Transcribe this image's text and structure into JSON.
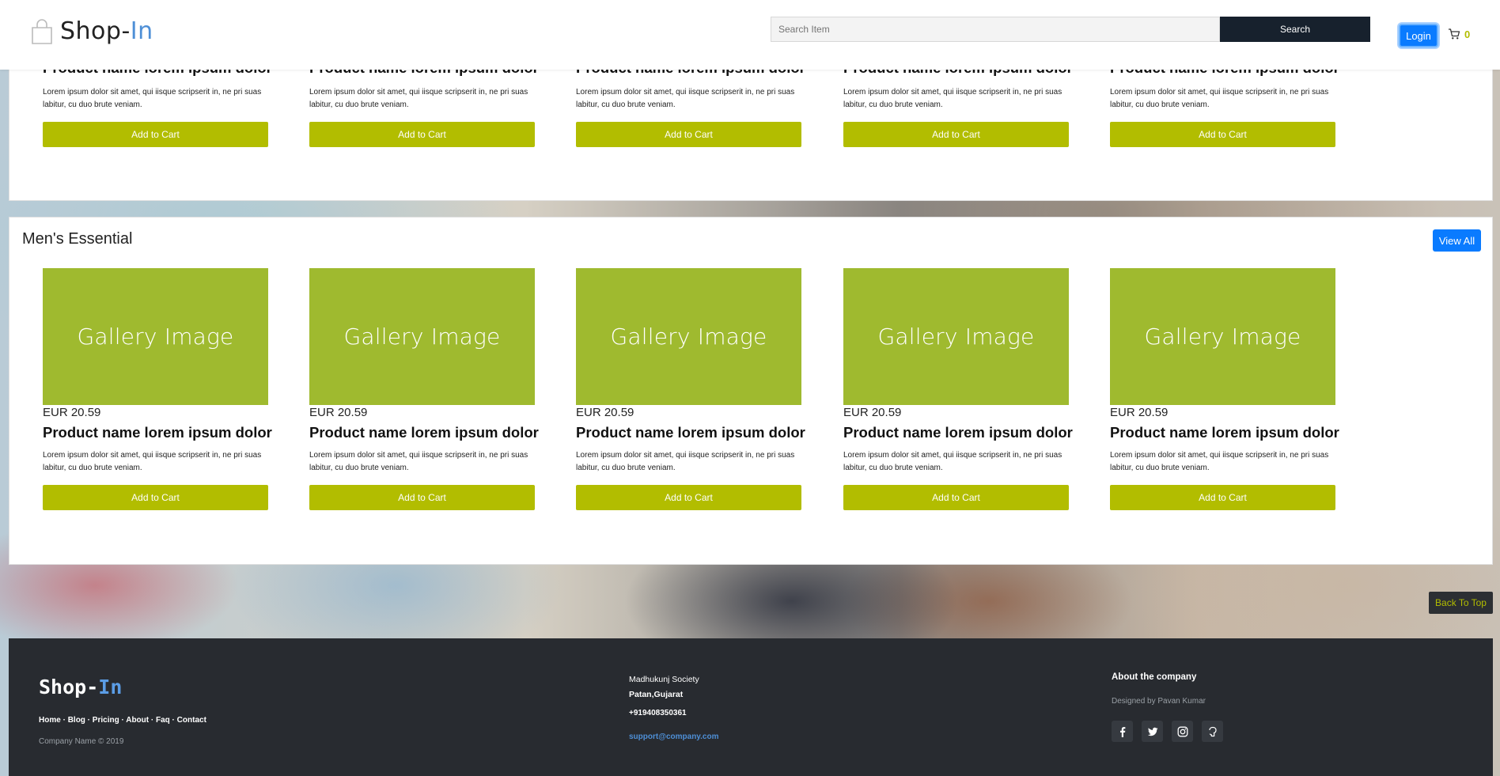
{
  "header": {
    "logo_text": "Shop-",
    "logo_accent": "In",
    "search_placeholder": "Search Item",
    "search_label": "Search",
    "login_label": "Login",
    "cart_count": "0"
  },
  "colors": {
    "accent_green": "#b2bd00",
    "gallery_green": "#9fba2f",
    "primary_blue": "#0a7bff",
    "dark": "#17212d"
  },
  "top_section": {
    "products": [
      {
        "name": "Product name lorem ipsum dolor",
        "desc": "Lorem ipsum dolor sit amet, qui iisque scripserit in, ne pri suas labitur, cu duo brute veniam.",
        "button": "Add to Cart"
      },
      {
        "name": "Product name lorem ipsum dolor",
        "desc": "Lorem ipsum dolor sit amet, qui iisque scripserit in, ne pri suas labitur, cu duo brute veniam.",
        "button": "Add to Cart"
      },
      {
        "name": "Product name lorem ipsum dolor",
        "desc": "Lorem ipsum dolor sit amet, qui iisque scripserit in, ne pri suas labitur, cu duo brute veniam.",
        "button": "Add to Cart"
      },
      {
        "name": "Product name lorem ipsum dolor",
        "desc": "Lorem ipsum dolor sit amet, qui iisque scripserit in, ne pri suas labitur, cu duo brute veniam.",
        "button": "Add to Cart"
      },
      {
        "name": "Product name lorem ipsum dolor",
        "desc": "Lorem ipsum dolor sit amet, qui iisque scripserit in, ne pri suas labitur, cu duo brute veniam.",
        "button": "Add to Cart"
      }
    ]
  },
  "mens_section": {
    "title": "Men's Essential",
    "view_all": "View All",
    "products": [
      {
        "image": "Gallery Image",
        "price": "EUR 20.59",
        "name": "Product name lorem ipsum dolor",
        "desc": "Lorem ipsum dolor sit amet, qui iisque scripserit in, ne pri suas labitur, cu duo brute veniam.",
        "button": "Add to Cart"
      },
      {
        "image": "Gallery Image",
        "price": "EUR 20.59",
        "name": "Product name lorem ipsum dolor",
        "desc": "Lorem ipsum dolor sit amet, qui iisque scripserit in, ne pri suas labitur, cu duo brute veniam.",
        "button": "Add to Cart"
      },
      {
        "image": "Gallery Image",
        "price": "EUR 20.59",
        "name": "Product name lorem ipsum dolor",
        "desc": "Lorem ipsum dolor sit amet, qui iisque scripserit in, ne pri suas labitur, cu duo brute veniam.",
        "button": "Add to Cart"
      },
      {
        "image": "Gallery Image",
        "price": "EUR 20.59",
        "name": "Product name lorem ipsum dolor",
        "desc": "Lorem ipsum dolor sit amet, qui iisque scripserit in, ne pri suas labitur, cu duo brute veniam.",
        "button": "Add to Cart"
      },
      {
        "image": "Gallery Image",
        "price": "EUR 20.59",
        "name": "Product name lorem ipsum dolor",
        "desc": "Lorem ipsum dolor sit amet, qui iisque scripserit in, ne pri suas labitur, cu duo brute veniam.",
        "button": "Add to Cart"
      }
    ]
  },
  "back_to_top": "Back To Top",
  "footer": {
    "logo_text": "Shop-",
    "logo_accent": "In",
    "links": [
      "Home",
      "Blog",
      "Pricing",
      "About",
      "Faq",
      "Contact"
    ],
    "link_separator": " · ",
    "copyright": "Company Name © 2019",
    "address_line1": "Madhukunj Society",
    "address_line2": "Patan,Gujarat",
    "phone": "+919408350361",
    "email": "support@company.com",
    "about_title": "About the company",
    "designed_by": "Designed by Pavan Kumar",
    "socials": [
      "facebook-icon",
      "twitter-icon",
      "instagram-icon",
      "github-icon"
    ]
  }
}
